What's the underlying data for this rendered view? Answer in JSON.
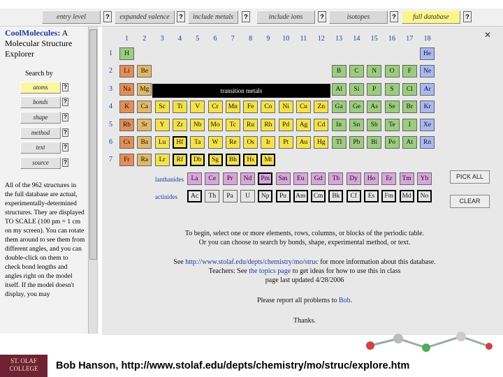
{
  "tabs": [
    {
      "label": "entry level",
      "active": false
    },
    {
      "label": "expanded valence",
      "active": false
    },
    {
      "label": "include metals",
      "active": false
    },
    {
      "label": "include ions",
      "active": false
    },
    {
      "label": "isotopes",
      "active": false
    },
    {
      "label": "full database",
      "active": true
    }
  ],
  "help_glyph": "?",
  "sidebar": {
    "title_bold": "CoolMolecules:",
    "title_rest": "A Molecular Structure Explorer",
    "search_by": "Search by",
    "buttons": [
      "atoms",
      "bonds",
      "shape",
      "method",
      "text",
      "source"
    ],
    "description": "All of the 962 structures in the full database are actual, experimentally-determined structures. They are displayed TO SCALE (100 pm = 1 cm on my screen). You can rotate them around to see them from different angles, and you can double-click on them to check bond lengths and angles right on the model itself. If the model doesn't display, you may"
  },
  "table": {
    "groups": [
      "1",
      "2",
      "3",
      "4",
      "5",
      "6",
      "7",
      "8",
      "9",
      "10",
      "11",
      "12",
      "13",
      "14",
      "15",
      "16",
      "17",
      "18"
    ],
    "periods": [
      "1",
      "2",
      "3",
      "4",
      "5",
      "6",
      "7"
    ],
    "transition_label": "transition metals",
    "lanthanides_label": "lanthanides",
    "actinides_label": "actinides",
    "elements": [
      {
        "s": "H",
        "g": 1,
        "p": 1,
        "c": "#9ccc7e",
        "sel": false
      },
      {
        "s": "He",
        "g": 18,
        "p": 1,
        "c": "#aab8f2",
        "sel": false
      },
      {
        "s": "Li",
        "g": 1,
        "p": 2,
        "c": "#e48e57",
        "sel": false
      },
      {
        "s": "Be",
        "g": 2,
        "p": 2,
        "c": "#e1b86a",
        "sel": false
      },
      {
        "s": "B",
        "g": 13,
        "p": 2,
        "c": "#9ccc7e",
        "sel": false
      },
      {
        "s": "C",
        "g": 14,
        "p": 2,
        "c": "#9ccc7e",
        "sel": false
      },
      {
        "s": "N",
        "g": 15,
        "p": 2,
        "c": "#9ccc7e",
        "sel": false
      },
      {
        "s": "O",
        "g": 16,
        "p": 2,
        "c": "#9ccc7e",
        "sel": false
      },
      {
        "s": "F",
        "g": 17,
        "p": 2,
        "c": "#9ccc7e",
        "sel": false
      },
      {
        "s": "Ne",
        "g": 18,
        "p": 2,
        "c": "#aab8f2",
        "sel": false
      },
      {
        "s": "Na",
        "g": 1,
        "p": 3,
        "c": "#e48e57",
        "sel": false
      },
      {
        "s": "Mg",
        "g": 2,
        "p": 3,
        "c": "#e1b86a",
        "sel": false
      },
      {
        "s": "Al",
        "g": 13,
        "p": 3,
        "c": "#9ccc7e",
        "sel": false
      },
      {
        "s": "Si",
        "g": 14,
        "p": 3,
        "c": "#9ccc7e",
        "sel": false
      },
      {
        "s": "P",
        "g": 15,
        "p": 3,
        "c": "#9ccc7e",
        "sel": false
      },
      {
        "s": "S",
        "g": 16,
        "p": 3,
        "c": "#9ccc7e",
        "sel": false
      },
      {
        "s": "Cl",
        "g": 17,
        "p": 3,
        "c": "#9ccc7e",
        "sel": false
      },
      {
        "s": "Ar",
        "g": 18,
        "p": 3,
        "c": "#aab8f2",
        "sel": false
      },
      {
        "s": "K",
        "g": 1,
        "p": 4,
        "c": "#e48e57",
        "sel": false
      },
      {
        "s": "Ca",
        "g": 2,
        "p": 4,
        "c": "#e1b86a",
        "sel": false
      },
      {
        "s": "Sc",
        "g": 3,
        "p": 4,
        "c": "#f4e24a",
        "sel": false
      },
      {
        "s": "Ti",
        "g": 4,
        "p": 4,
        "c": "#f4e24a",
        "sel": false
      },
      {
        "s": "V",
        "g": 5,
        "p": 4,
        "c": "#f4e24a",
        "sel": false
      },
      {
        "s": "Cr",
        "g": 6,
        "p": 4,
        "c": "#f4e24a",
        "sel": false
      },
      {
        "s": "Mn",
        "g": 7,
        "p": 4,
        "c": "#f4e24a",
        "sel": false
      },
      {
        "s": "Fe",
        "g": 8,
        "p": 4,
        "c": "#f4e24a",
        "sel": false
      },
      {
        "s": "Co",
        "g": 9,
        "p": 4,
        "c": "#f4e24a",
        "sel": false
      },
      {
        "s": "Ni",
        "g": 10,
        "p": 4,
        "c": "#f4e24a",
        "sel": false
      },
      {
        "s": "Cu",
        "g": 11,
        "p": 4,
        "c": "#f4e24a",
        "sel": false
      },
      {
        "s": "Zn",
        "g": 12,
        "p": 4,
        "c": "#f4e24a",
        "sel": false
      },
      {
        "s": "Ga",
        "g": 13,
        "p": 4,
        "c": "#9ccc7e",
        "sel": false
      },
      {
        "s": "Ge",
        "g": 14,
        "p": 4,
        "c": "#9ccc7e",
        "sel": false
      },
      {
        "s": "As",
        "g": 15,
        "p": 4,
        "c": "#9ccc7e",
        "sel": false
      },
      {
        "s": "Se",
        "g": 16,
        "p": 4,
        "c": "#9ccc7e",
        "sel": false
      },
      {
        "s": "Br",
        "g": 17,
        "p": 4,
        "c": "#9ccc7e",
        "sel": false
      },
      {
        "s": "Kr",
        "g": 18,
        "p": 4,
        "c": "#aab8f2",
        "sel": false
      },
      {
        "s": "Rb",
        "g": 1,
        "p": 5,
        "c": "#e48e57",
        "sel": false
      },
      {
        "s": "Sr",
        "g": 2,
        "p": 5,
        "c": "#e1b86a",
        "sel": false
      },
      {
        "s": "Y",
        "g": 3,
        "p": 5,
        "c": "#f4e24a",
        "sel": false
      },
      {
        "s": "Zr",
        "g": 4,
        "p": 5,
        "c": "#f4e24a",
        "sel": false
      },
      {
        "s": "Nb",
        "g": 5,
        "p": 5,
        "c": "#f4e24a",
        "sel": false
      },
      {
        "s": "Mo",
        "g": 6,
        "p": 5,
        "c": "#f4e24a",
        "sel": false
      },
      {
        "s": "Tc",
        "g": 7,
        "p": 5,
        "c": "#f4e24a",
        "sel": false
      },
      {
        "s": "Ru",
        "g": 8,
        "p": 5,
        "c": "#f4e24a",
        "sel": false
      },
      {
        "s": "Rh",
        "g": 9,
        "p": 5,
        "c": "#f4e24a",
        "sel": false
      },
      {
        "s": "Pd",
        "g": 10,
        "p": 5,
        "c": "#f4e24a",
        "sel": false
      },
      {
        "s": "Ag",
        "g": 11,
        "p": 5,
        "c": "#f4e24a",
        "sel": false
      },
      {
        "s": "Cd",
        "g": 12,
        "p": 5,
        "c": "#f4e24a",
        "sel": false
      },
      {
        "s": "In",
        "g": 13,
        "p": 5,
        "c": "#9ccc7e",
        "sel": false
      },
      {
        "s": "Sn",
        "g": 14,
        "p": 5,
        "c": "#9ccc7e",
        "sel": false
      },
      {
        "s": "Sb",
        "g": 15,
        "p": 5,
        "c": "#9ccc7e",
        "sel": false
      },
      {
        "s": "Te",
        "g": 16,
        "p": 5,
        "c": "#9ccc7e",
        "sel": false
      },
      {
        "s": "I",
        "g": 17,
        "p": 5,
        "c": "#9ccc7e",
        "sel": false
      },
      {
        "s": "Xe",
        "g": 18,
        "p": 5,
        "c": "#aab8f2",
        "sel": false
      },
      {
        "s": "Cs",
        "g": 1,
        "p": 6,
        "c": "#e48e57",
        "sel": false
      },
      {
        "s": "Ba",
        "g": 2,
        "p": 6,
        "c": "#e1b86a",
        "sel": false
      },
      {
        "s": "Lu",
        "g": 3,
        "p": 6,
        "c": "#f4e24a",
        "sel": false
      },
      {
        "s": "Hf",
        "g": 4,
        "p": 6,
        "c": "#f4e24a",
        "sel": true
      },
      {
        "s": "Ta",
        "g": 5,
        "p": 6,
        "c": "#f4e24a",
        "sel": false
      },
      {
        "s": "W",
        "g": 6,
        "p": 6,
        "c": "#f4e24a",
        "sel": false
      },
      {
        "s": "Re",
        "g": 7,
        "p": 6,
        "c": "#f4e24a",
        "sel": false
      },
      {
        "s": "Os",
        "g": 8,
        "p": 6,
        "c": "#f4e24a",
        "sel": false
      },
      {
        "s": "Ir",
        "g": 9,
        "p": 6,
        "c": "#f4e24a",
        "sel": false
      },
      {
        "s": "Pt",
        "g": 10,
        "p": 6,
        "c": "#f4e24a",
        "sel": false
      },
      {
        "s": "Au",
        "g": 11,
        "p": 6,
        "c": "#f4e24a",
        "sel": false
      },
      {
        "s": "Hg",
        "g": 12,
        "p": 6,
        "c": "#f4e24a",
        "sel": false
      },
      {
        "s": "Tl",
        "g": 13,
        "p": 6,
        "c": "#9ccc7e",
        "sel": false
      },
      {
        "s": "Pb",
        "g": 14,
        "p": 6,
        "c": "#9ccc7e",
        "sel": false
      },
      {
        "s": "Bi",
        "g": 15,
        "p": 6,
        "c": "#9ccc7e",
        "sel": false
      },
      {
        "s": "Po",
        "g": 16,
        "p": 6,
        "c": "#9ccc7e",
        "sel": false
      },
      {
        "s": "At",
        "g": 17,
        "p": 6,
        "c": "#9ccc7e",
        "sel": false
      },
      {
        "s": "Rn",
        "g": 18,
        "p": 6,
        "c": "#aab8f2",
        "sel": false
      },
      {
        "s": "Fr",
        "g": 1,
        "p": 7,
        "c": "#e48e57",
        "sel": false
      },
      {
        "s": "Ra",
        "g": 2,
        "p": 7,
        "c": "#e1b86a",
        "sel": false
      },
      {
        "s": "Lr",
        "g": 3,
        "p": 7,
        "c": "#f4e24a",
        "sel": false
      },
      {
        "s": "Rf",
        "g": 4,
        "p": 7,
        "c": "#f4e24a",
        "sel": true
      },
      {
        "s": "Db",
        "g": 5,
        "p": 7,
        "c": "#f4e24a",
        "sel": true
      },
      {
        "s": "Sg",
        "g": 6,
        "p": 7,
        "c": "#f4e24a",
        "sel": true
      },
      {
        "s": "Bh",
        "g": 7,
        "p": 7,
        "c": "#f4e24a",
        "sel": true
      },
      {
        "s": "Hs",
        "g": 8,
        "p": 7,
        "c": "#f4e24a",
        "sel": true
      },
      {
        "s": "Mt",
        "g": 9,
        "p": 7,
        "c": "#f4e24a",
        "sel": true
      }
    ],
    "lanthanides": [
      {
        "s": "La",
        "c": "#d9a5dc",
        "sel": false
      },
      {
        "s": "Ce",
        "c": "#d9a5dc",
        "sel": false
      },
      {
        "s": "Pr",
        "c": "#d9a5dc",
        "sel": false
      },
      {
        "s": "Nd",
        "c": "#d9a5dc",
        "sel": false
      },
      {
        "s": "Pm",
        "c": "#d9a5dc",
        "sel": true
      },
      {
        "s": "Sm",
        "c": "#d9a5dc",
        "sel": false
      },
      {
        "s": "Eu",
        "c": "#d9a5dc",
        "sel": false
      },
      {
        "s": "Gd",
        "c": "#d9a5dc",
        "sel": false
      },
      {
        "s": "Tb",
        "c": "#d9a5dc",
        "sel": false
      },
      {
        "s": "Dy",
        "c": "#d9a5dc",
        "sel": false
      },
      {
        "s": "Ho",
        "c": "#d9a5dc",
        "sel": false
      },
      {
        "s": "Er",
        "c": "#d9a5dc",
        "sel": false
      },
      {
        "s": "Tm",
        "c": "#d9a5dc",
        "sel": false
      },
      {
        "s": "Yb",
        "c": "#d9a5dc",
        "sel": false
      }
    ],
    "actinides": [
      {
        "s": "Ac",
        "c": "#e6e6e6",
        "sel": true
      },
      {
        "s": "Th",
        "c": "#e6e6e6",
        "sel": false
      },
      {
        "s": "Pa",
        "c": "#e6e6e6",
        "sel": false
      },
      {
        "s": "U",
        "c": "#e6e6e6",
        "sel": false
      },
      {
        "s": "Np",
        "c": "#e6e6e6",
        "sel": true
      },
      {
        "s": "Pu",
        "c": "#e6e6e6",
        "sel": true
      },
      {
        "s": "Am",
        "c": "#e6e6e6",
        "sel": true
      },
      {
        "s": "Cm",
        "c": "#e6e6e6",
        "sel": true
      },
      {
        "s": "Bk",
        "c": "#e6e6e6",
        "sel": true
      },
      {
        "s": "Cf",
        "c": "#e6e6e6",
        "sel": true
      },
      {
        "s": "Es",
        "c": "#e6e6e6",
        "sel": true
      },
      {
        "s": "Fm",
        "c": "#e6e6e6",
        "sel": true
      },
      {
        "s": "Md",
        "c": "#e6e6e6",
        "sel": true
      },
      {
        "s": "No",
        "c": "#e6e6e6",
        "sel": true
      }
    ]
  },
  "buttons": {
    "pick_all": "PICK ALL",
    "clear": "CLEAR"
  },
  "info": {
    "line1": "To begin, select one or more elements, rows, columns, or blocks of the periodic table.",
    "line2": "Or you can choose to search by bonds, shape, experimental method, or text.",
    "line3_pre": "See",
    "line3_link": "http://www.stolaf.edu/depts/chemistry/mo/struc",
    "line3_post": "for more information about this database.",
    "line4_pre": "Teachers: See",
    "line4_link": "the topics page",
    "line4_post": "to get ideas for how to use this in class",
    "line5": "page last updated 4/28/2006",
    "line6_pre": "Please report all problems to",
    "line6_link": "Bob",
    "line6_post": ".",
    "line7": "Thanks."
  },
  "logo": {
    "line1": "ST. OLAF",
    "line2": "COLLEGE"
  },
  "footer": "Bob Hanson, http://www.stolaf.edu/depts/chemistry/mo/struc/explore.htm",
  "colors": {
    "active_tab": "#fcf58a",
    "link": "#1f3aa3",
    "transition_bar": "#000000",
    "logo": "#6e2233"
  }
}
